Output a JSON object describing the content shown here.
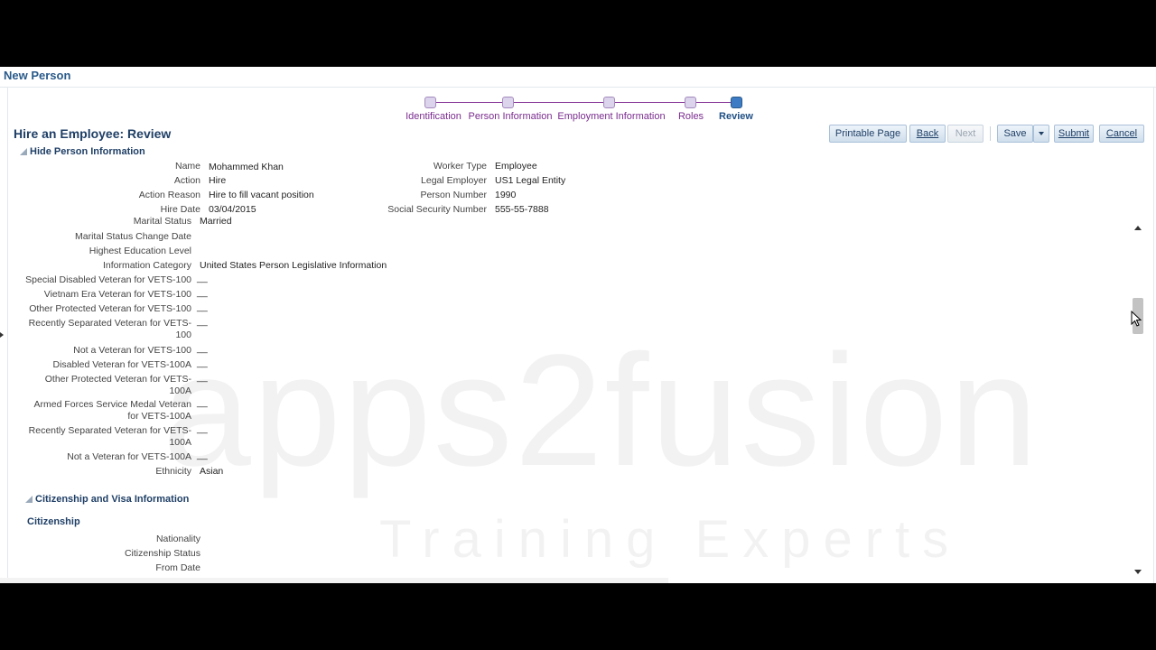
{
  "page": {
    "title": "New Person"
  },
  "train": {
    "steps": [
      {
        "label": "Identification"
      },
      {
        "label": "Person Information"
      },
      {
        "label": "Employment Information"
      },
      {
        "label": "Roles"
      },
      {
        "label": "Review"
      }
    ],
    "current": "Review"
  },
  "review": {
    "title": "Hire an Employee: Review"
  },
  "toolbar": {
    "printable_label": "Printable Page",
    "back_label": "Back",
    "next_label": "Next",
    "save_label": "Save",
    "submit_label": "Submit",
    "cancel_label": "Cancel"
  },
  "person_section": {
    "header": "Hide Person Information",
    "left_fields": [
      {
        "label": "Name",
        "value": "Mohammed Khan"
      },
      {
        "label": "Action",
        "value": "Hire"
      },
      {
        "label": "Action Reason",
        "value": "Hire to fill vacant position"
      },
      {
        "label": "Hire Date",
        "value": "03/04/2015"
      }
    ],
    "right_fields": [
      {
        "label": "Worker Type",
        "value": "Employee"
      },
      {
        "label": "Legal Employer",
        "value": "US1 Legal Entity"
      },
      {
        "label": "Person Number",
        "value": "1990"
      },
      {
        "label": "Social Security Number",
        "value": "555-55-7888"
      }
    ]
  },
  "details": {
    "marital_status": {
      "label": "Marital Status",
      "value": "Married"
    },
    "fields": [
      {
        "label": "Marital Status Change Date",
        "value": ""
      },
      {
        "label": "Highest Education Level",
        "value": ""
      },
      {
        "label": "Information Category",
        "value": "United States Person Legislative Information"
      },
      {
        "label": "Special Disabled Veteran for VETS-100",
        "value": "__"
      },
      {
        "label": "Vietnam Era Veteran for VETS-100",
        "value": "__"
      },
      {
        "label": "Other Protected Veteran for VETS-100",
        "value": "__"
      },
      {
        "label": "Recently Separated Veteran for VETS-100",
        "value": "__"
      },
      {
        "label": "Not a Veteran for VETS-100",
        "value": "__"
      },
      {
        "label": "Disabled Veteran for VETS-100A",
        "value": "__"
      },
      {
        "label": "Other Protected Veteran for VETS-100A",
        "value": "__"
      },
      {
        "label": "Armed Forces Service Medal Veteran for VETS-100A",
        "value": "__"
      },
      {
        "label": "Recently Separated Veteran for VETS-100A",
        "value": "__"
      },
      {
        "label": "Not a Veteran for VETS-100A",
        "value": "__"
      },
      {
        "label": "Ethnicity",
        "value": "Asian"
      }
    ]
  },
  "citizenship_section": {
    "header": "Citizenship and Visa Information",
    "subheader": "Citizenship",
    "fields": [
      {
        "label": "Nationality",
        "value": ""
      },
      {
        "label": "Citizenship Status",
        "value": ""
      },
      {
        "label": "From Date",
        "value": ""
      }
    ]
  },
  "watermark": {
    "text": "apps2fusion",
    "sub": "Training Experts"
  },
  "colors": {
    "accent": "#1f3f66",
    "train_purple": "#7a2c8f",
    "current_step": "#3d7bc4"
  }
}
